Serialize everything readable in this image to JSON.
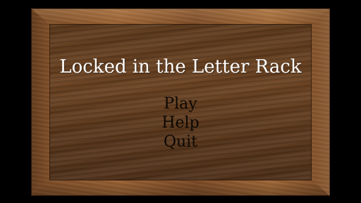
{
  "title": "Locked in the Letter Rack",
  "menu": {
    "items": [
      {
        "label": "Play"
      },
      {
        "label": "Help"
      },
      {
        "label": "Quit"
      }
    ]
  },
  "colors": {
    "background": "#000000",
    "frame_wood": "#8a5630",
    "panel_wood": "#5e3a1c",
    "title_text": "#ffffff",
    "menu_text": "#0b0703"
  }
}
